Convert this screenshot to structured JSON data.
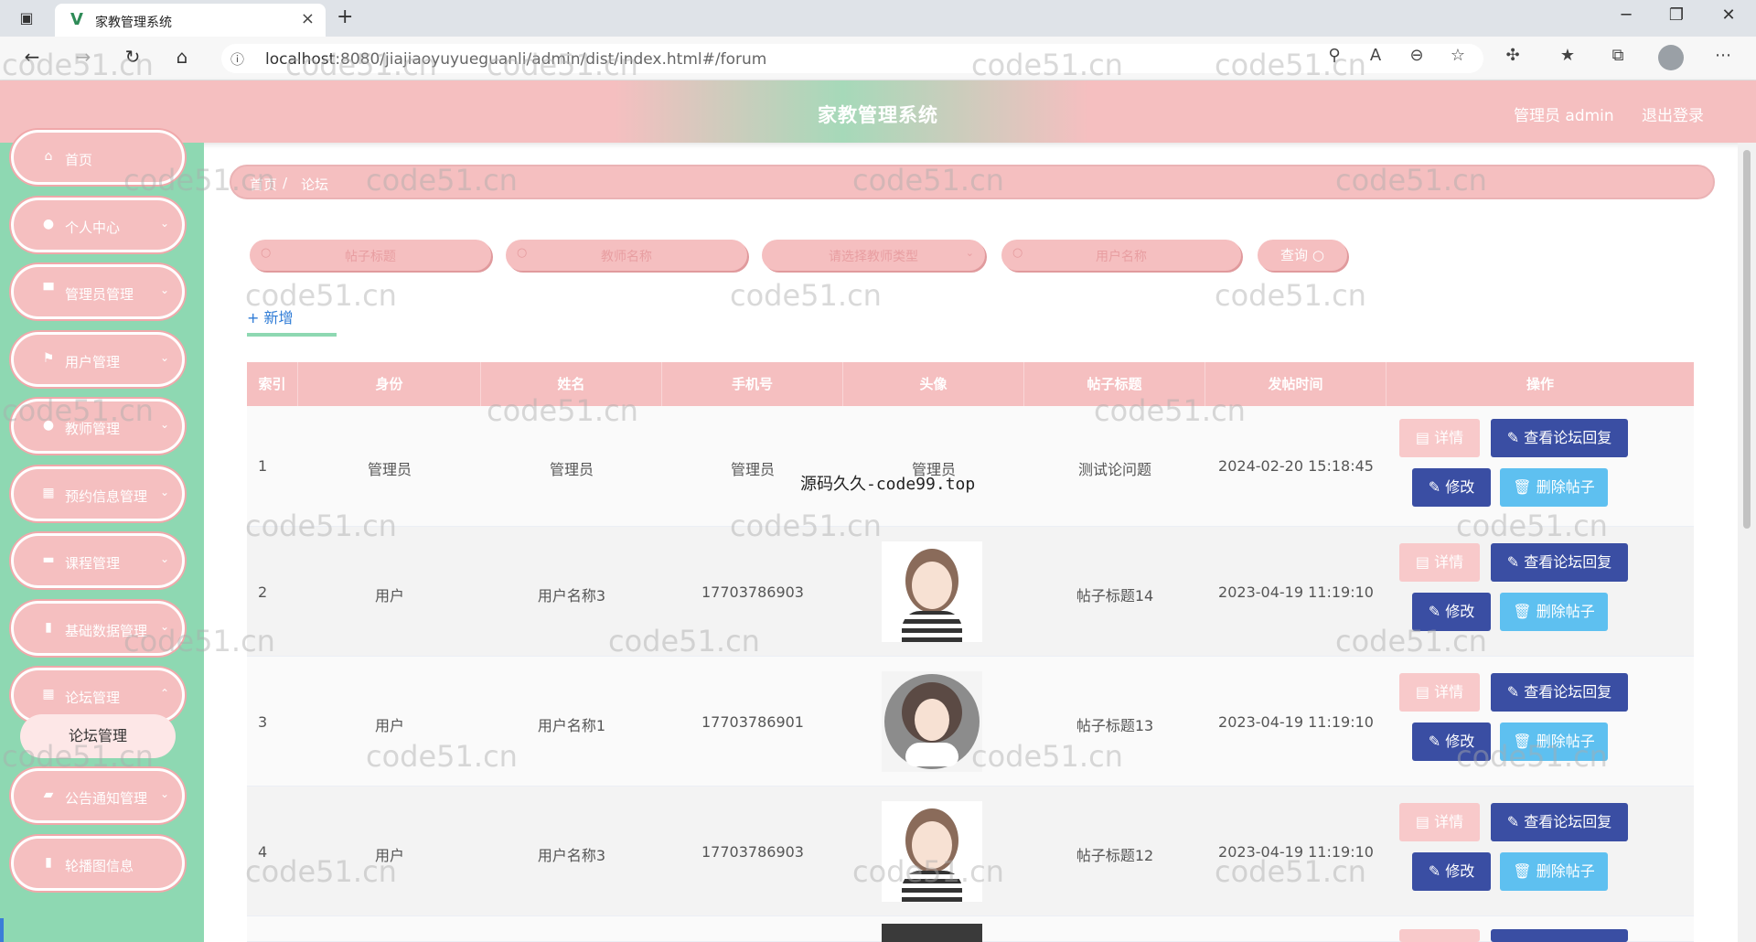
{
  "browser": {
    "tab_title": "家教管理系统",
    "url_host": "localhost",
    "url_rest": ":8080/jiajiaoyuyueguanli/admin/dist/index.html#/forum",
    "new_tab": "+",
    "close_tab": "×"
  },
  "header": {
    "title": "家教管理系统",
    "user": "管理员 admin",
    "logout": "退出登录"
  },
  "sidebar": {
    "items": [
      {
        "label": "首页",
        "icon": "⌂"
      },
      {
        "label": "个人中心",
        "icon": "●"
      },
      {
        "label": "管理员管理",
        "icon": "▀"
      },
      {
        "label": "用户管理",
        "icon": "⚑"
      },
      {
        "label": "教师管理",
        "icon": "●"
      },
      {
        "label": "预约信息管理",
        "icon": "▦"
      },
      {
        "label": "课程管理",
        "icon": "▬"
      },
      {
        "label": "基础数据管理",
        "icon": "▮"
      },
      {
        "label": "论坛管理",
        "icon": "▦"
      },
      {
        "label": "公告通知管理",
        "icon": "▰"
      },
      {
        "label": "轮播图信息",
        "icon": "▮"
      }
    ],
    "active_sub": "论坛管理"
  },
  "breadcrumb": {
    "home": "首页",
    "sep": "/",
    "current": "论坛"
  },
  "search": {
    "title_placeholder": "帖子标题",
    "teacher_placeholder": "教师名称",
    "type_placeholder": "请选择教师类型",
    "user_placeholder": "用户名称",
    "query_label": "查询"
  },
  "add_label": "+ 新增",
  "table": {
    "columns": [
      "索引",
      "身份",
      "姓名",
      "手机号",
      "头像",
      "帖子标题",
      "发帖时间",
      "操作"
    ],
    "rows": [
      {
        "index": "1",
        "role": "管理员",
        "name": "管理员",
        "phone": "管理员",
        "avatar": "管理员",
        "title": "测试论问题",
        "time": "2024-02-20 15:18:45"
      },
      {
        "index": "2",
        "role": "用户",
        "name": "用户名称3",
        "phone": "17703786903",
        "avatar": "",
        "title": "帖子标题14",
        "time": "2023-04-19 11:19:10"
      },
      {
        "index": "3",
        "role": "用户",
        "name": "用户名称1",
        "phone": "17703786901",
        "avatar": "",
        "title": "帖子标题13",
        "time": "2023-04-19 11:19:10"
      },
      {
        "index": "4",
        "role": "用户",
        "name": "用户名称3",
        "phone": "17703786903",
        "avatar": "",
        "title": "帖子标题12",
        "time": "2023-04-19 11:19:10"
      }
    ],
    "actions": {
      "detail": "详情",
      "reply": "查看论坛回复",
      "edit": "修改",
      "delete": "删除帖子"
    }
  },
  "watermark_text": "code51.cn",
  "overlay_text": "源码久久-code99.top"
}
